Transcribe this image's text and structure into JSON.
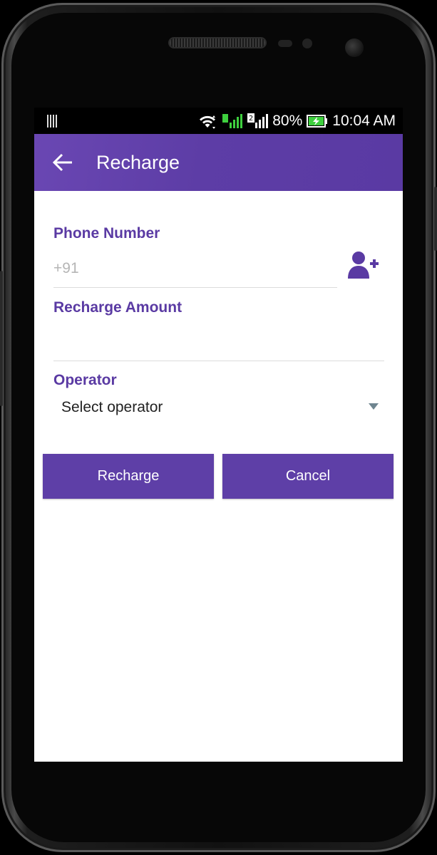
{
  "status_bar": {
    "battery_percent": "80%",
    "time": "10:04 AM",
    "sim2_label": "2"
  },
  "app_bar": {
    "title": "Recharge"
  },
  "form": {
    "phone_label": "Phone Number",
    "phone_placeholder": "+91",
    "phone_value": "",
    "amount_label": "Recharge Amount",
    "amount_value": "",
    "operator_label": "Operator",
    "operator_selected": "Select operator"
  },
  "actions": {
    "recharge_label": "Recharge",
    "cancel_label": "Cancel"
  },
  "theme": {
    "primary": "#5e3fa7",
    "label_color": "#5a3aa3",
    "sim_signal_green": "#3ecf3e"
  },
  "icons": {
    "back": "arrow-left-icon",
    "add_contact": "add-contact-icon",
    "dropdown": "triangle-down-icon",
    "wifi": "wifi-icon",
    "signal": "signal-icon",
    "battery": "battery-charging-icon"
  }
}
